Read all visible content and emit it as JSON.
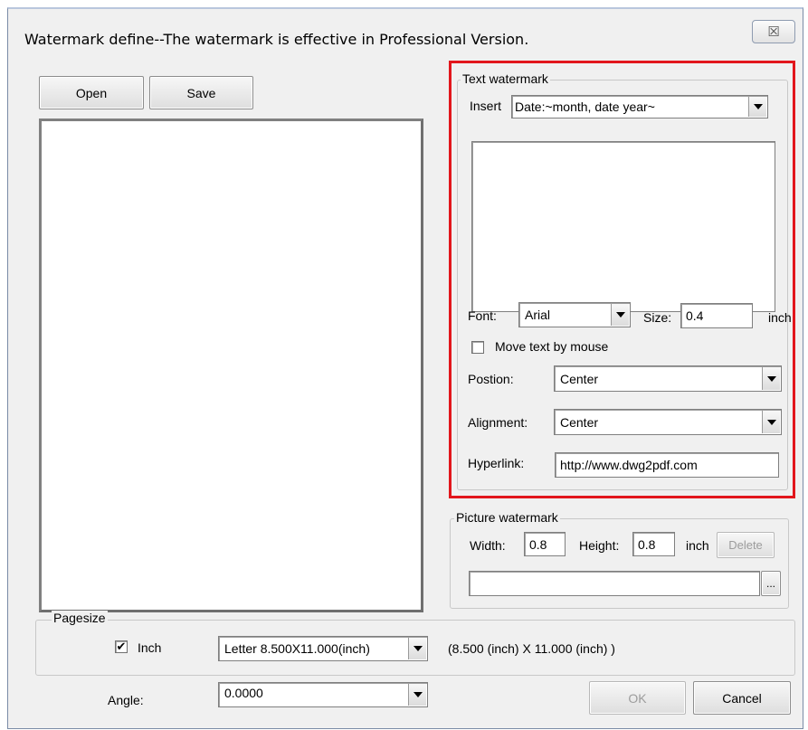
{
  "window": {
    "title": "Watermark define--The watermark is effective in Professional Version.",
    "close_glyph": "☒"
  },
  "toolbar": {
    "open_label": "Open",
    "save_label": "Save"
  },
  "text_watermark": {
    "legend": "Text watermark",
    "insert_label": "Insert",
    "insert_value": "Date:~month, date year~",
    "text_value": "",
    "font_label": "Font:",
    "font_value": "Arial",
    "size_label": "Size:",
    "size_value": "0.4",
    "size_unit": "inch",
    "move_label": "Move text by mouse",
    "move_checked_glyph": "",
    "position_label": "Postion:",
    "position_value": "Center",
    "alignment_label": "Alignment:",
    "alignment_value": "Center",
    "hyperlink_label": "Hyperlink:",
    "hyperlink_value": "http://www.dwg2pdf.com"
  },
  "picture_watermark": {
    "legend": "Picture watermark",
    "width_label": "Width:",
    "width_value": "0.8",
    "height_label": "Height:",
    "height_value": "0.8",
    "unit": "inch",
    "delete_label": "Delete",
    "path_value": "",
    "browse_label": "..."
  },
  "pagesize": {
    "legend": "Pagesize",
    "inch_label": "Inch",
    "inch_checked_glyph": "✔",
    "size_value": "Letter  8.500X11.000(inch)",
    "dimensions_text": "(8.500 (inch) X 11.000 (inch) )"
  },
  "angle": {
    "label": "Angle:",
    "value": "0.0000"
  },
  "footer": {
    "ok_label": "OK",
    "cancel_label": "Cancel"
  },
  "colors": {
    "highlight_border": "#e2161c",
    "dialog_bg": "#f0f0f0"
  }
}
